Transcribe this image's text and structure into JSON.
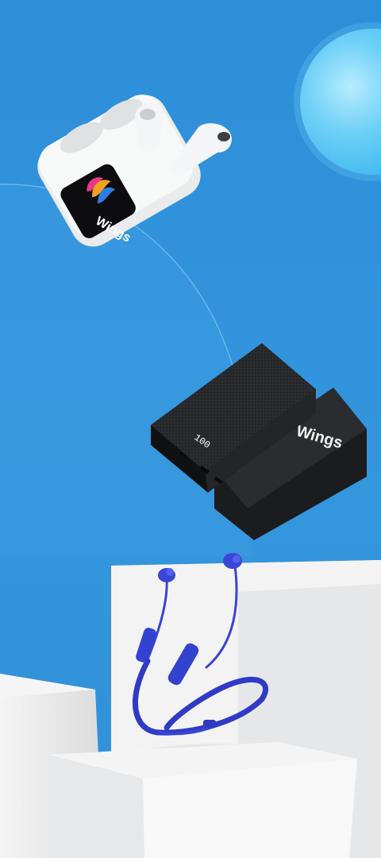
{
  "brand": {
    "earbuds_case_logo": "Wings",
    "powerbank_logo": "Wings",
    "powerbank_display": "100"
  },
  "colors": {
    "background": "#2f8fda",
    "background_light": "#3d9be2",
    "orb": "#5cc6f5",
    "powerbank": "#232527",
    "neckband": "#3846d6",
    "pedestal": "#eeeeee"
  },
  "icons": {
    "earbuds_case": "earbuds-case-icon",
    "earbud": "earbud-icon",
    "powerbank": "powerbank-icon",
    "neckband": "neckband-earphones-icon",
    "orb": "glow-orb-icon"
  }
}
